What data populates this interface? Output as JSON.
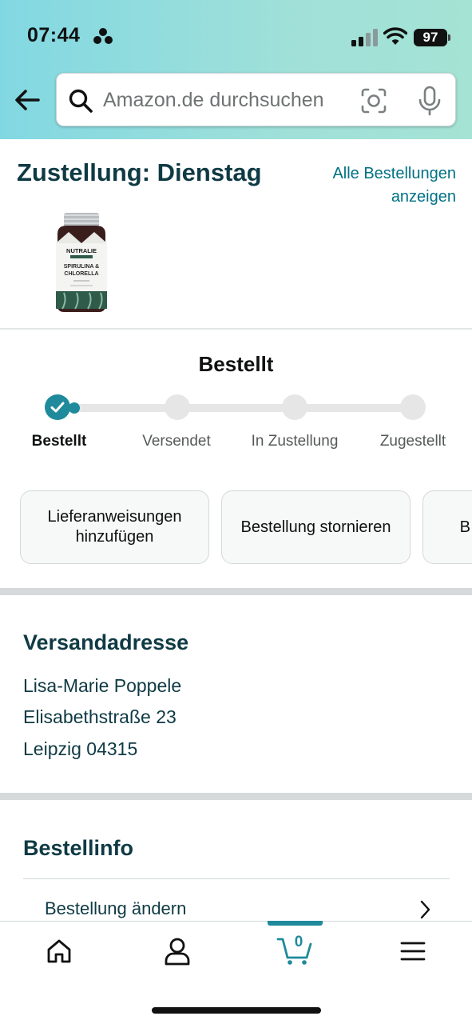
{
  "status_bar": {
    "time": "07:44",
    "battery": "97"
  },
  "search": {
    "placeholder": "Amazon.de durchsuchen"
  },
  "order": {
    "delivery_title": "Zustellung: Dienstag",
    "all_orders_link": "Alle Bestellungen anzeigen",
    "product_brand": "NUTRALIE",
    "product_name_line1": "SPIRULINA &",
    "product_name_line2": "CHLORELLA"
  },
  "tracking": {
    "heading": "Bestellt",
    "steps": [
      {
        "label": "Bestellt",
        "done": true
      },
      {
        "label": "Versendet",
        "done": false
      },
      {
        "label": "In Zustellung",
        "done": false
      },
      {
        "label": "Zugestellt",
        "done": false
      }
    ]
  },
  "actions": {
    "delivery_instructions": "Lieferanweisungen hinzufügen",
    "cancel_order": "Bestellung stornieren",
    "third_partial": "B"
  },
  "shipping": {
    "title": "Versandadresse",
    "name": "Lisa-Marie Poppele",
    "street": "Elisabethstraße 23",
    "city": "Leipzig 04315"
  },
  "order_info": {
    "title": "Bestellinfo",
    "change_order": "Bestellung ändern"
  },
  "tabbar": {
    "cart_count": "0"
  },
  "colors": {
    "accent": "#1f8a9b",
    "link": "#007185",
    "heading": "#0f3a44",
    "header_gradient_start": "#82d8e2",
    "header_gradient_end": "#a5e3d4"
  }
}
